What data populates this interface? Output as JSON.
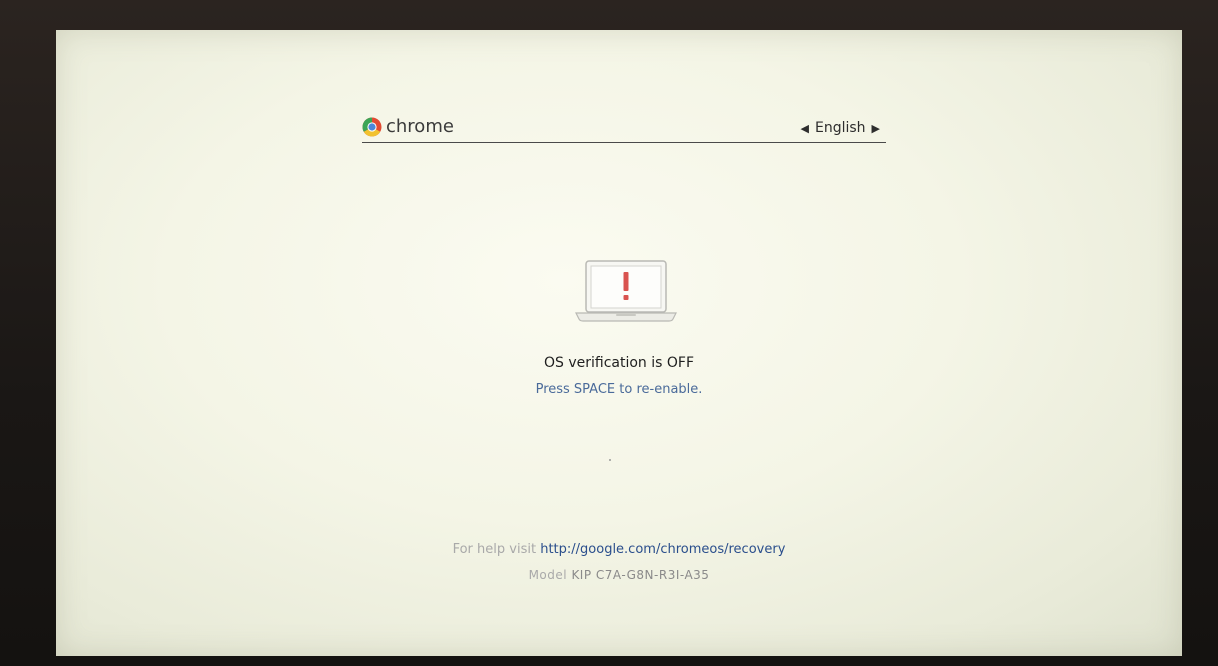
{
  "header": {
    "logo_text": "chrome",
    "language": "English",
    "prev_language_icon": "triangle-left-icon",
    "next_language_icon": "triangle-right-icon"
  },
  "main": {
    "icon": "laptop-warning-icon",
    "title": "OS verification is OFF",
    "subtitle": "Press SPACE to re-enable."
  },
  "footer": {
    "help_prefix": "For help visit",
    "help_link": "http://google.com/chromeos/recovery",
    "model_label": "Model",
    "model_value": "KIP C7A-G8N-R3I-A35"
  },
  "colors": {
    "screen_bg": "#f4f5e6",
    "link": "#2a4e8c",
    "subtitle": "#4a6a9a",
    "warning": "#d9534f"
  }
}
